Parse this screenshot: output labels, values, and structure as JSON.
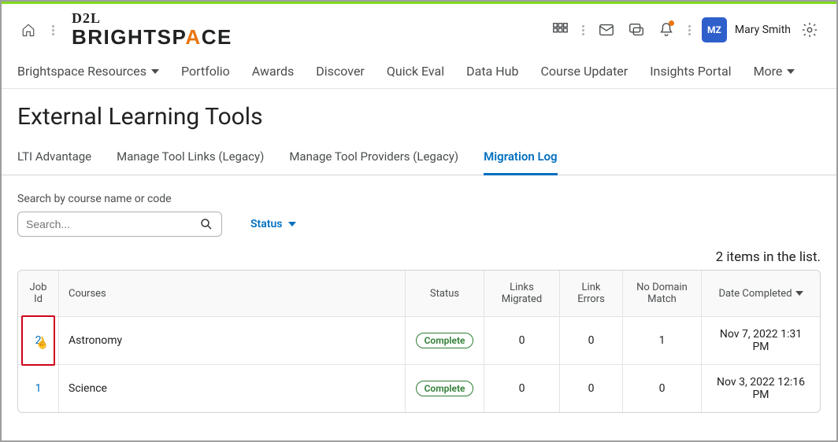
{
  "header": {
    "logo_top": "D2L",
    "logo_bottom_pre": "BRIGHTSP",
    "logo_bottom_accent": "A",
    "logo_bottom_post": "CE",
    "avatar_initials": "MZ",
    "user_name": "Mary Smith"
  },
  "nav": {
    "items": [
      {
        "label": "Brightspace Resources",
        "has_menu": true
      },
      {
        "label": "Portfolio"
      },
      {
        "label": "Awards"
      },
      {
        "label": "Discover"
      },
      {
        "label": "Quick Eval"
      },
      {
        "label": "Data Hub"
      },
      {
        "label": "Course Updater"
      },
      {
        "label": "Insights Portal"
      },
      {
        "label": "More",
        "has_menu": true
      }
    ]
  },
  "page": {
    "title": "External Learning Tools"
  },
  "tabs": {
    "items": [
      {
        "label": "LTI Advantage"
      },
      {
        "label": "Manage Tool Links (Legacy)"
      },
      {
        "label": "Manage Tool Providers (Legacy)"
      },
      {
        "label": "Migration Log"
      }
    ],
    "active": 3
  },
  "search": {
    "label": "Search by course name or code",
    "placeholder": "Search...",
    "status_label": "Status"
  },
  "table": {
    "count_text": "2 items in the list.",
    "headers": {
      "job_id": "Job Id",
      "courses": "Courses",
      "status": "Status",
      "links_migrated": "Links Migrated",
      "link_errors": "Link Errors",
      "no_domain_match": "No Domain Match",
      "date_completed": "Date Completed"
    },
    "rows": [
      {
        "job_id": "2",
        "course": "Astronomy",
        "status": "Complete",
        "links_migrated": "0",
        "link_errors": "0",
        "no_domain_match": "1",
        "date_completed": "Nov 7, 2022 1:31 PM",
        "highlighted": true
      },
      {
        "job_id": "1",
        "course": "Science",
        "status": "Complete",
        "links_migrated": "0",
        "link_errors": "0",
        "no_domain_match": "0",
        "date_completed": "Nov 3, 2022 12:16 PM"
      }
    ]
  }
}
